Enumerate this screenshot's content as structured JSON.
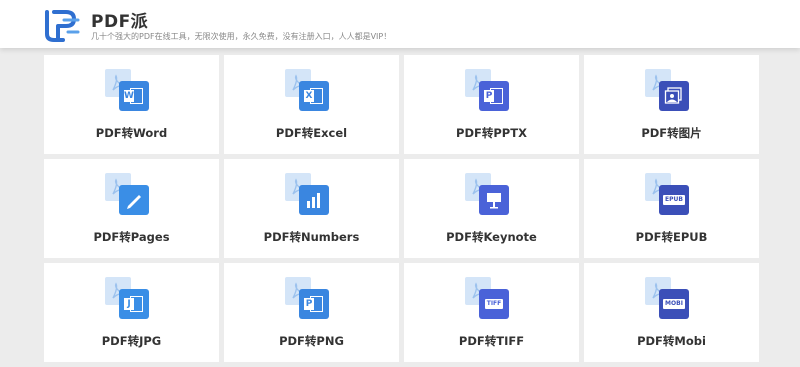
{
  "header": {
    "brand": "PDF派",
    "slogan": "几十个强大的PDF在线工具，无限次使用，永久免费，没有注册入口，人人都是VIP！"
  },
  "tools": [
    {
      "label": "PDF转Word",
      "icon": "word-icon",
      "color": "#3a86e0",
      "badge": "W"
    },
    {
      "label": "PDF转Excel",
      "icon": "excel-icon",
      "color": "#3a86e0",
      "badge": "X"
    },
    {
      "label": "PDF转PPTX",
      "icon": "pptx-icon",
      "color": "#4a62d8",
      "badge": "P"
    },
    {
      "label": "PDF转图片",
      "icon": "image-icon",
      "color": "#3b4fb8",
      "badge": ""
    },
    {
      "label": "PDF转Pages",
      "icon": "pages-icon",
      "color": "#3a8ee6",
      "badge": ""
    },
    {
      "label": "PDF转Numbers",
      "icon": "numbers-icon",
      "color": "#3a86e0",
      "badge": ""
    },
    {
      "label": "PDF转Keynote",
      "icon": "keynote-icon",
      "color": "#4a62d8",
      "badge": ""
    },
    {
      "label": "PDF转EPUB",
      "icon": "epub-icon",
      "color": "#3b4fb8",
      "badge": "EPUB"
    },
    {
      "label": "PDF转JPG",
      "icon": "jpg-icon",
      "color": "#3a8ee6",
      "badge": "J"
    },
    {
      "label": "PDF转PNG",
      "icon": "png-icon",
      "color": "#3a86e0",
      "badge": "P"
    },
    {
      "label": "PDF转TIFF",
      "icon": "tiff-icon",
      "color": "#4a62d8",
      "badge": "TIFF"
    },
    {
      "label": "PDF转Mobi",
      "icon": "mobi-icon",
      "color": "#3b4fb8",
      "badge": "MOBI"
    }
  ]
}
